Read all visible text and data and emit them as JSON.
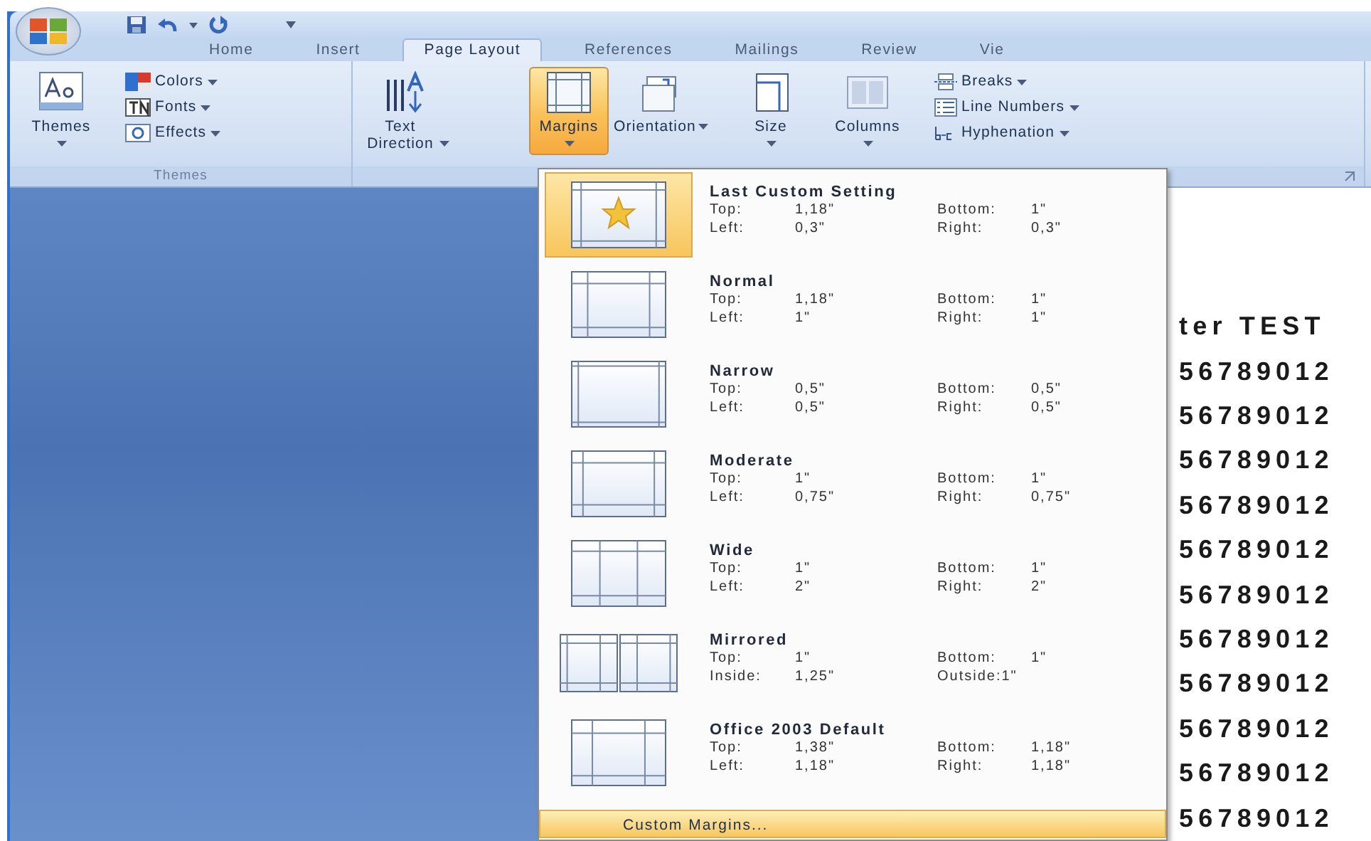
{
  "tabs": [
    {
      "label": "Home",
      "selected": false
    },
    {
      "label": "Insert",
      "selected": false
    },
    {
      "label": "Page Layout",
      "selected": true
    },
    {
      "label": "References",
      "selected": false
    },
    {
      "label": "Mailings",
      "selected": false
    },
    {
      "label": "Review",
      "selected": false
    },
    {
      "label": "Vie",
      "selected": false
    }
  ],
  "ribbon": {
    "groups": [
      {
        "label": "Themes",
        "buttons": [
          {
            "kind": "large",
            "label": "Themes",
            "dropdown": true,
            "selected": false
          },
          {
            "kind": "small",
            "label": "Colors",
            "dropdown": true,
            "selected": false
          },
          {
            "kind": "small",
            "label": "Fonts",
            "dropdown": true,
            "selected": false
          },
          {
            "kind": "small",
            "label": "Effects",
            "dropdown": true,
            "selected": false
          }
        ]
      },
      {
        "buttons": [
          {
            "kind": "large",
            "label": "Text Direction",
            "dropdown": true,
            "selected": false
          },
          {
            "kind": "large",
            "label": "Margins",
            "dropdown": true,
            "selected": true
          },
          {
            "kind": "large",
            "label": "Orientation",
            "dropdown": true,
            "selected": false
          },
          {
            "kind": "large",
            "label": "Size",
            "dropdown": true,
            "selected": false
          },
          {
            "kind": "large",
            "label": "Columns",
            "dropdown": true,
            "selected": false
          },
          {
            "kind": "small",
            "label": "Breaks",
            "dropdown": true,
            "selected": false
          },
          {
            "kind": "small",
            "label": "Line Numbers",
            "dropdown": true,
            "selected": false
          },
          {
            "kind": "small",
            "label": "Hyphenation",
            "dropdown": true,
            "selected": false
          }
        ]
      }
    ]
  },
  "margins_menu": {
    "items": [
      {
        "kind": "custom",
        "title": "Last Custom Setting",
        "selected": true,
        "rows": [
          [
            "Top:",
            "1,18\"",
            "Bottom:",
            "1\""
          ],
          [
            "Left:",
            "0,3\"",
            "Right:",
            "0,3\""
          ]
        ]
      },
      {
        "kind": "normal",
        "title": "Normal",
        "selected": false,
        "rows": [
          [
            "Top:",
            "1,18\"",
            "Bottom:",
            "1\""
          ],
          [
            "Left:",
            "1\"",
            "Right:",
            "1\""
          ]
        ]
      },
      {
        "kind": "narrow",
        "title": "Narrow",
        "selected": false,
        "rows": [
          [
            "Top:",
            "0,5\"",
            "Bottom:",
            "0,5\""
          ],
          [
            "Left:",
            "0,5\"",
            "Right:",
            "0,5\""
          ]
        ]
      },
      {
        "kind": "moderate",
        "title": "Moderate",
        "selected": false,
        "rows": [
          [
            "Top:",
            "1\"",
            "Bottom:",
            "1\""
          ],
          [
            "Left:",
            "0,75\"",
            "Right:",
            "0,75\""
          ]
        ]
      },
      {
        "kind": "wide",
        "title": "Wide",
        "selected": false,
        "rows": [
          [
            "Top:",
            "1\"",
            "Bottom:",
            "1\""
          ],
          [
            "Left:",
            "2\"",
            "Right:",
            "2\""
          ]
        ]
      },
      {
        "kind": "mirrored",
        "title": "Mirrored",
        "selected": false,
        "rows": [
          [
            "Top:",
            "1\"",
            "Bottom:",
            "1\""
          ],
          [
            "Inside:",
            "1,25\"",
            "Outside:1\""
          ]
        ]
      },
      {
        "kind": "default",
        "title": "Office 2003 Default",
        "selected": false,
        "rows": [
          [
            "Top:",
            "1,38\"",
            "Bottom:",
            "1,18\""
          ],
          [
            "Left:",
            "1,18\"",
            "Right:",
            "1,18\""
          ]
        ]
      }
    ],
    "footer": {
      "label": "Custom Margins...",
      "selected": true
    }
  },
  "document": {
    "lines": [
      "ter TEST",
      "56789012",
      "56789012",
      "56789012",
      "56789012",
      "56789012",
      "56789012",
      "56789012",
      "56789012",
      "56789012",
      "56789012",
      "56789012"
    ]
  }
}
